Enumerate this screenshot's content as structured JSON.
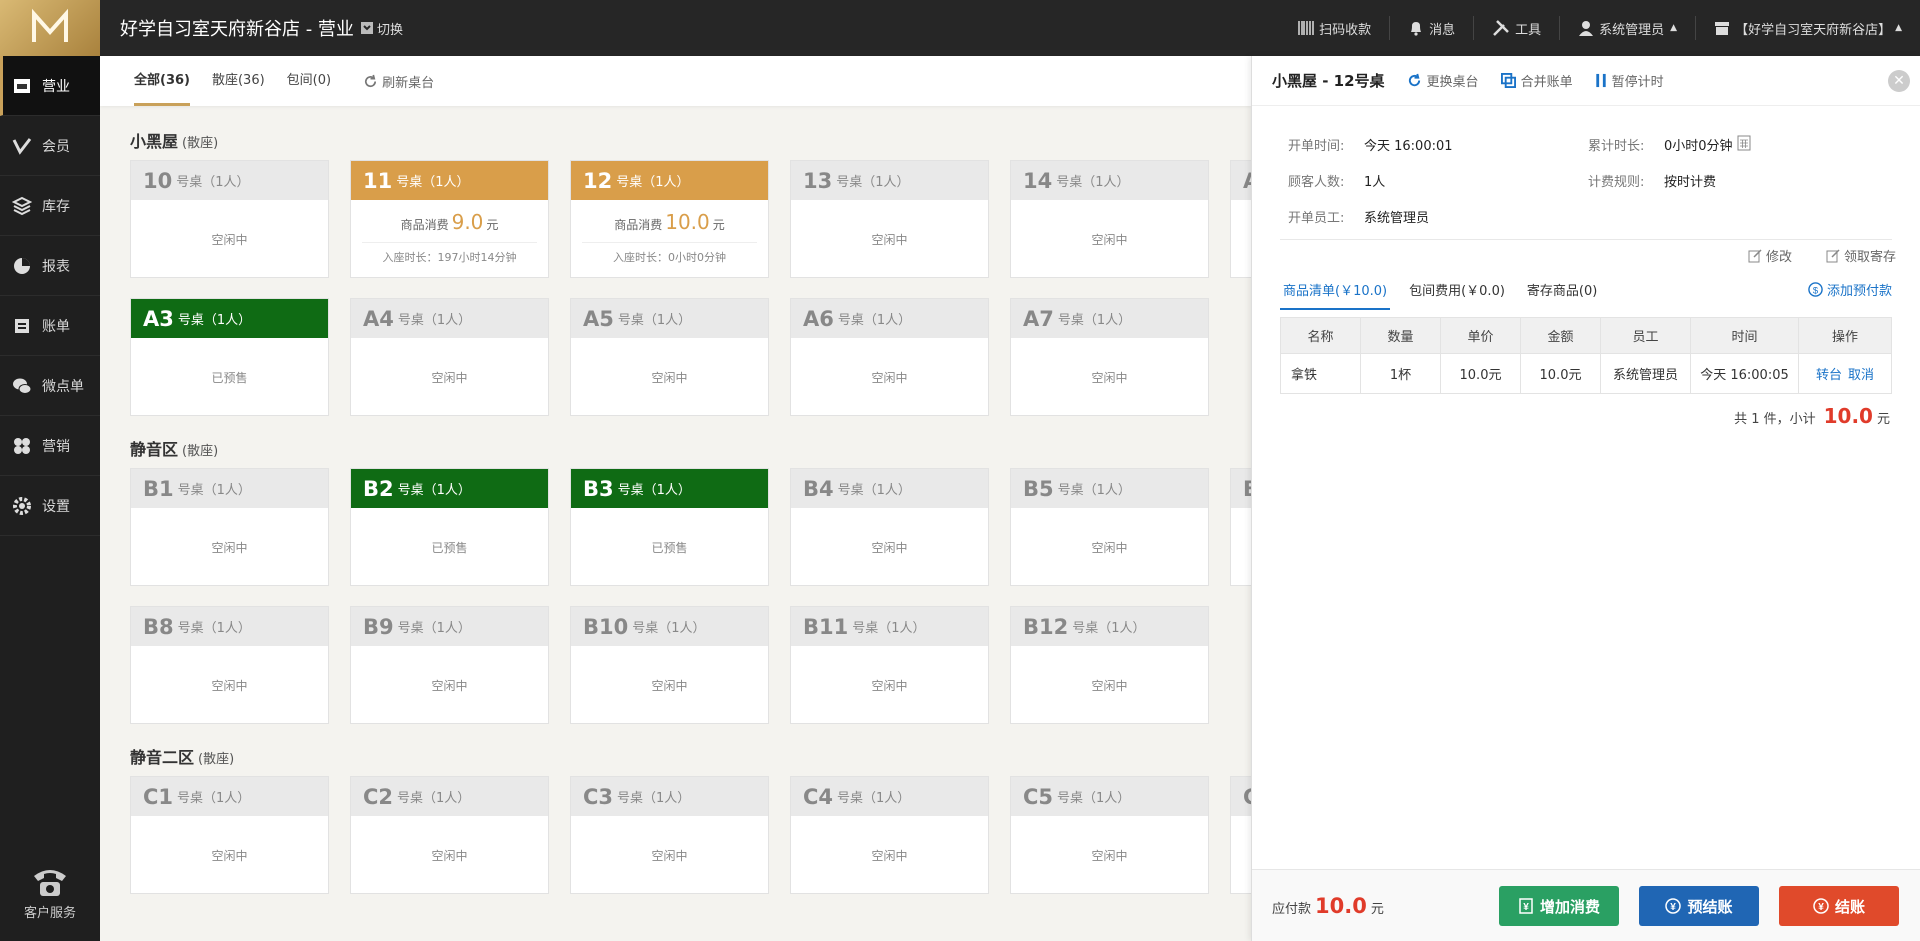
{
  "colors": {
    "accent": "#c9a15a",
    "occupied": "#d99e4a",
    "reserved": "#0f6b14",
    "link": "#1a73c8",
    "danger": "#e03b2a"
  },
  "header": {
    "title": "好学自习室天府新谷店 - 营业",
    "switch": "切换",
    "scan": "扫码收款",
    "messages": "消息",
    "tools": "工具",
    "user": "系统管理员",
    "store": "【好学自习室天府新谷店】"
  },
  "sidebar": {
    "items": [
      {
        "label": "营业",
        "icon": "shop-icon"
      },
      {
        "label": "会员",
        "icon": "vip-icon"
      },
      {
        "label": "库存",
        "icon": "layers-icon"
      },
      {
        "label": "报表",
        "icon": "pie-icon"
      },
      {
        "label": "账单",
        "icon": "bill-icon"
      },
      {
        "label": "微点单",
        "icon": "wechat-icon"
      },
      {
        "label": "营销",
        "icon": "clover-icon"
      },
      {
        "label": "设置",
        "icon": "gear-icon"
      }
    ],
    "service": "客户服务"
  },
  "tabs": {
    "all": "全部(36)",
    "loose": "散座(36)",
    "room": "包间(0)",
    "refresh": "刷新桌台"
  },
  "zones": {
    "z1": {
      "name": "小黑屋",
      "type": "(散座)"
    },
    "z2": {
      "name": "静音区",
      "type": "(散座)"
    },
    "z3": {
      "name": "静音二区",
      "type": "(散座)"
    }
  },
  "cards": {
    "c10": {
      "num": "10",
      "label": "号桌（1人）",
      "status": "空闲中"
    },
    "c11": {
      "num": "11",
      "label": "号桌（1人）",
      "consume_label": "商品消费",
      "amount": "9.0",
      "unit": "元",
      "duration": "入座时长：197小时14分钟"
    },
    "c12": {
      "num": "12",
      "label": "号桌（1人）",
      "consume_label": "商品消费",
      "amount": "10.0",
      "unit": "元",
      "duration": "入座时长：0小时0分钟"
    },
    "c13": {
      "num": "13",
      "label": "号桌（1人）",
      "status": "空闲中"
    },
    "c14": {
      "num": "14",
      "label": "号桌（1人）",
      "status": "空闲中"
    },
    "c15": {
      "num": "A",
      "label": "",
      "status": ""
    },
    "cA3": {
      "num": "A3",
      "label": "号桌（1人）",
      "status": "已预售"
    },
    "cA4": {
      "num": "A4",
      "label": "号桌（1人）",
      "status": "空闲中"
    },
    "cA5": {
      "num": "A5",
      "label": "号桌（1人）",
      "status": "空闲中"
    },
    "cA6": {
      "num": "A6",
      "label": "号桌（1人）",
      "status": "空闲中"
    },
    "cA7": {
      "num": "A7",
      "label": "号桌（1人）",
      "status": "空闲中"
    },
    "cB1": {
      "num": "B1",
      "label": "号桌（1人）",
      "status": "空闲中"
    },
    "cB2": {
      "num": "B2",
      "label": "号桌（1人）",
      "status": "已预售"
    },
    "cB3": {
      "num": "B3",
      "label": "号桌（1人）",
      "status": "已预售"
    },
    "cB4": {
      "num": "B4",
      "label": "号桌（1人）",
      "status": "空闲中"
    },
    "cB5": {
      "num": "B5",
      "label": "号桌（1人）",
      "status": "空闲中"
    },
    "cB6": {
      "num": "B",
      "label": "",
      "status": ""
    },
    "cB8": {
      "num": "B8",
      "label": "号桌（1人）",
      "status": "空闲中"
    },
    "cB9": {
      "num": "B9",
      "label": "号桌（1人）",
      "status": "空闲中"
    },
    "cB10": {
      "num": "B10",
      "label": "号桌（1人）",
      "status": "空闲中"
    },
    "cB11": {
      "num": "B11",
      "label": "号桌（1人）",
      "status": "空闲中"
    },
    "cB12": {
      "num": "B12",
      "label": "号桌（1人）",
      "status": "空闲中"
    },
    "cC1": {
      "num": "C1",
      "label": "号桌（1人）",
      "status": "空闲中"
    },
    "cC2": {
      "num": "C2",
      "label": "号桌（1人）",
      "status": "空闲中"
    },
    "cC3": {
      "num": "C3",
      "label": "号桌（1人）",
      "status": "空闲中"
    },
    "cC4": {
      "num": "C4",
      "label": "号桌（1人）",
      "status": "空闲中"
    },
    "cC5": {
      "num": "C5",
      "label": "号桌（1人）",
      "status": "空闲中"
    },
    "cC6": {
      "num": "C",
      "label": "",
      "status": ""
    }
  },
  "panel": {
    "title": "小黑屋 - 12号桌",
    "change_table": "更换桌台",
    "merge_bill": "合并账单",
    "pause_timer": "暂停计时",
    "info": {
      "open_time_k": "开单时间:",
      "open_time_v": "今天 16:00:01",
      "duration_k": "累计时长:",
      "duration_v": "0小时0分钟",
      "guests_k": "顾客人数:",
      "guests_v": "1人",
      "rule_k": "计费规则:",
      "rule_v": "按时计费",
      "staff_k": "开单员工:",
      "staff_v": "系统管理员"
    },
    "modify": "修改",
    "claim": "领取寄存",
    "tabs": {
      "goods": "商品清单(￥10.0)",
      "room": "包间费用(￥0.0)",
      "stored": "寄存商品(0)"
    },
    "add_prepay": "添加预付款",
    "columns": [
      "名称",
      "数量",
      "单价",
      "金额",
      "员工",
      "时间",
      "操作"
    ],
    "rows": [
      {
        "name": "拿铁",
        "qty": "1杯",
        "price": "10.0元",
        "amount": "10.0元",
        "staff": "系统管理员",
        "time": "今天 16:00:05",
        "op1": "转台",
        "op2": "取消"
      }
    ],
    "summary_pre": "共 1 件，小计",
    "summary_total": "10.0",
    "summary_unit": "元",
    "payable_label": "应付款",
    "payable_amount": "10.0",
    "payable_unit": "元",
    "btn_add": "增加消费",
    "btn_pre": "预结账",
    "btn_pay": "结账"
  }
}
